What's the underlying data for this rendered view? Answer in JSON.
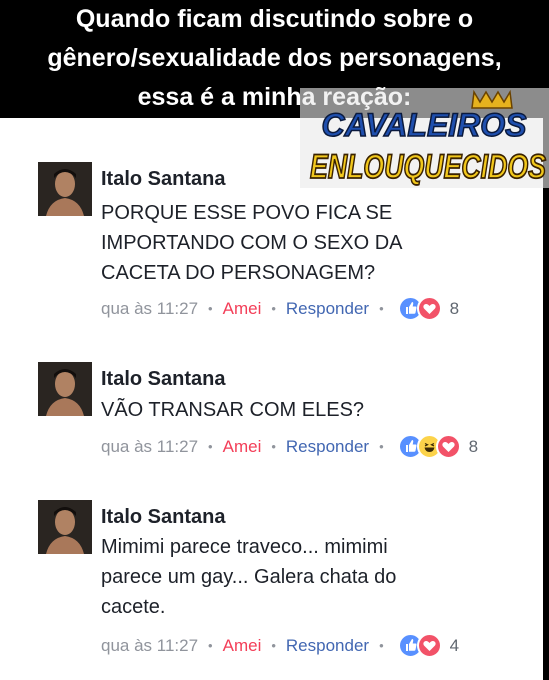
{
  "header": {
    "lines": [
      "Quando ficam discutindo sobre o",
      "gênero/sexualidade dos personagens,",
      "essa é a minha reação:"
    ]
  },
  "logo": {
    "line1": "CAVALEIROS",
    "line2": "ENLOUQUECIDOS"
  },
  "comments": [
    {
      "author": "Italo Santana",
      "text_lines": [
        "PORQUE ESSE POVO FICA SE",
        "IMPORTANDO COM O SEXO DA",
        "CACETA DO PERSONAGEM?"
      ],
      "time": "qua às 11:27",
      "reaction_label": "Amei",
      "reply_label": "Responder",
      "reactions": [
        "like-icon",
        "love-icon"
      ],
      "reaction_count": "8"
    },
    {
      "author": "Italo Santana",
      "text_lines": [
        "VÃO TRANSAR COM ELES?"
      ],
      "time": "qua às 11:27",
      "reaction_label": "Amei",
      "reply_label": "Responder",
      "reactions": [
        "like-icon",
        "haha-icon",
        "love-icon"
      ],
      "reaction_count": "8"
    },
    {
      "author": "Italo Santana",
      "text_lines": [
        "Mimimi parece traveco... mimimi",
        "parece um gay... Galera chata do",
        "cacete."
      ],
      "time": "qua às 11:27",
      "reaction_label": "Amei",
      "reply_label": "Responder",
      "reactions": [
        "like-icon",
        "love-icon"
      ],
      "reaction_count": "4"
    }
  ],
  "colors": {
    "author": "#1d2129",
    "meta": "#90949c",
    "loved": "#f33e58",
    "link": "#4267b2",
    "like": "#5890ff",
    "love": "#f25268",
    "haha": "#fcd34a"
  }
}
